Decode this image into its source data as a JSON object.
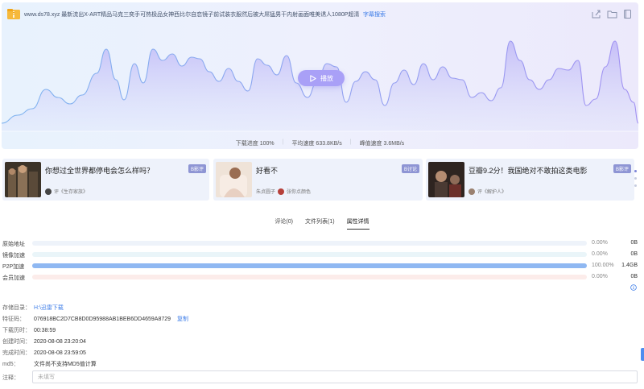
{
  "file": {
    "title": "www.ds78.xyz 最新流出X-ART精品马克三奕手可热极品女神西比尔自恋镜子前试装衣服然后被大屌猛男干内射画面唯美诱人1080P超清",
    "subtitle_search": "字幕搜索"
  },
  "toolbar": {
    "icons": [
      "share-icon",
      "folder-icon",
      "book-icon"
    ]
  },
  "play": {
    "label": "播放"
  },
  "stats": {
    "progress": "下载进度 100%",
    "avg_speed": "平均速度 633.8KB/s",
    "peak_speed": "峰值速度 3.6MB/s"
  },
  "colors": {
    "accent": "#a9a0f7",
    "link": "#3f7ee8",
    "p2p_bar": "#8fb8f2"
  },
  "recommendations": [
    {
      "title": "你想过全世界都停电会怎么样吗？",
      "tag": "B影评",
      "footer": "评《生存家族》"
    },
    {
      "title": "好看不",
      "tag": "B讨论",
      "footer": "朱贞圆子",
      "footer2": "张你点颜色"
    },
    {
      "title": "豆瓣9.2分！我国绝对不敢拍这类电影",
      "tag": "B影评",
      "footer": "评《解护人》"
    }
  ],
  "tabs": [
    {
      "label": "评论(0)"
    },
    {
      "label": "文件列表(1)"
    },
    {
      "label": "属性详情"
    }
  ],
  "sources": [
    {
      "label": "原始地址",
      "percent": "0.00%",
      "size": "0B",
      "fraction": 0.0
    },
    {
      "label": "镜像加速",
      "percent": "0.00%",
      "size": "0B",
      "fraction": 0.0
    },
    {
      "label": "P2P加速",
      "percent": "100.00%",
      "size": "1.4GB",
      "fraction": 1.0
    },
    {
      "label": "会员加速",
      "percent": "0.00%",
      "size": "0B",
      "fraction": 0.0
    }
  ],
  "details": {
    "dir_label": "存储目录：",
    "dir_value": "H:\\迅雷下载",
    "hash_label": "特征码：",
    "hash_value": "076918BC2D7CB8D0D95988AB1BEB6DD4659A8729",
    "hash_copy": "复制",
    "elapsed_label": "下载历时：",
    "elapsed_value": "00:38:59",
    "created_label": "创建时间：",
    "created_value": "2020-08-08 23:20:04",
    "finished_label": "完成时间：",
    "finished_value": "2020-08-08 23:59:05",
    "md5_label": "md5：",
    "md5_value": "文件尚不支持MD5值计算",
    "note_label": "注释：",
    "note_placeholder": "未填写"
  }
}
